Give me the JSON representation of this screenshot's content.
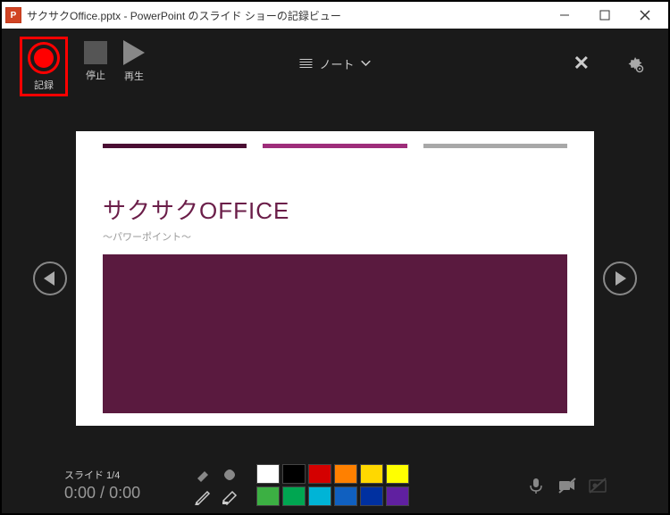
{
  "window": {
    "app_icon": "P",
    "title": "サクサクOffice.pptx - PowerPoint のスライド ショーの記録ビュー"
  },
  "toolbar": {
    "record": "記録",
    "stop": "停止",
    "play": "再生",
    "notes": "ノート"
  },
  "slide": {
    "title": "サクサクOFFICE",
    "subtitle": "～パワーポイント～",
    "bar_colors": [
      "#4a0e33",
      "#9e2d7a",
      "#a8a8a8"
    ],
    "block_color": "#5a1a3f"
  },
  "status": {
    "slide_indicator": "スライド 1/4",
    "time_current": "0:00",
    "time_sep": " / ",
    "time_total": "0:00"
  },
  "swatches": {
    "row1": [
      "#ffffff",
      "#000000",
      "#d40000",
      "#ff8000",
      "#ffd800",
      "#ffff00"
    ],
    "row2": [
      "#3cb043",
      "#00a651",
      "#00b4d6",
      "#1060c0",
      "#0030a0",
      "#6020a0"
    ]
  }
}
